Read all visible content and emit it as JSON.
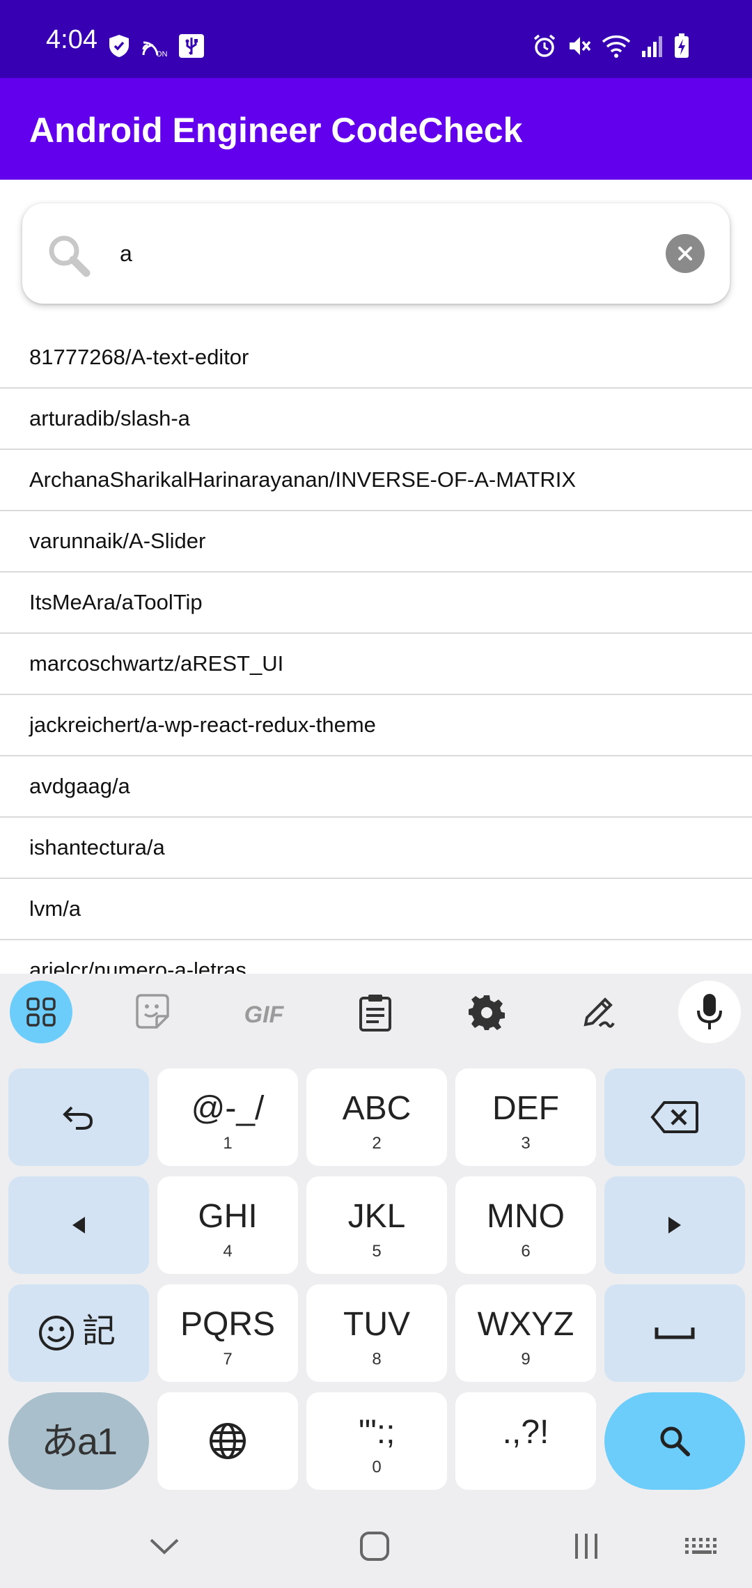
{
  "status_bar": {
    "time": "4:04",
    "left_icons": [
      "shield-check-icon",
      "nfc-on-icon",
      "usb-icon"
    ],
    "right_icons": [
      "alarm-icon",
      "mute-icon",
      "wifi-icon",
      "signal-icon",
      "battery-charging-icon"
    ],
    "background": "#3700B3"
  },
  "app_bar": {
    "title": "Android Engineer CodeCheck",
    "background": "#6200EE"
  },
  "search": {
    "value": "a",
    "placeholder": ""
  },
  "repositories": [
    "81777268/A-text-editor",
    "arturadib/slash-a",
    "ArchanaSharikalHarinarayanan/INVERSE-OF-A-MATRIX",
    "varunnaik/A-Slider",
    "ItsMeAra/aToolTip",
    "marcoschwartz/aREST_UI",
    "jackreichert/a-wp-react-redux-theme",
    "avdgaag/a",
    "ishantectura/a",
    "lvm/a",
    "arielcr/numero-a-letras"
  ],
  "keyboard": {
    "toolbar": [
      "apps-icon",
      "sticker-icon",
      "gif-icon",
      "clipboard-icon",
      "settings-icon",
      "handwriting-icon",
      "mic-icon"
    ],
    "gif_label": "GIF",
    "keys": {
      "symbols": {
        "main": "@-_/",
        "sub": "1"
      },
      "abc": {
        "main": "ABC",
        "sub": "2"
      },
      "def": {
        "main": "DEF",
        "sub": "3"
      },
      "ghi": {
        "main": "GHI",
        "sub": "4"
      },
      "jkl": {
        "main": "JKL",
        "sub": "5"
      },
      "mno": {
        "main": "MNO",
        "sub": "6"
      },
      "pqrs": {
        "main": "PQRS",
        "sub": "7"
      },
      "tuv": {
        "main": "TUV",
        "sub": "8"
      },
      "wxyz": {
        "main": "WXYZ",
        "sub": "9"
      },
      "punct": {
        "main": "'\":;",
        "sub": "0"
      },
      "punct2": {
        "main": ".,?!",
        "sub": ""
      },
      "emoji_kanji": "記",
      "mode": "あa1"
    },
    "accent": "#6ccdfa"
  },
  "nav_bar": [
    "back-chevron-icon",
    "home-icon",
    "recents-icon",
    "keyboard-toggle-icon"
  ]
}
